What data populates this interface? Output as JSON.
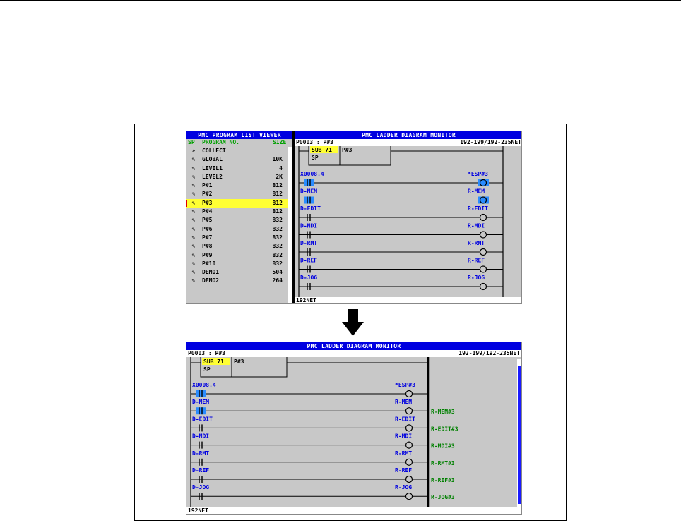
{
  "top": {
    "list_title": "PMC PROGRAM LIST VIEWER",
    "list_header": {
      "sp": "SP",
      "program_no": "PROGRAM NO.",
      "size": "SIZE"
    },
    "programs": [
      {
        "name": "COLLECT",
        "size": "",
        "icon": "magnifier-icon"
      },
      {
        "name": "GLOBAL",
        "size": "10K",
        "icon": "pencil-icon"
      },
      {
        "name": "LEVEL1",
        "size": "4",
        "icon": "pencil-icon"
      },
      {
        "name": "LEVEL2",
        "size": "2K",
        "icon": "pencil-icon"
      },
      {
        "name": "P#1",
        "size": "812",
        "icon": "pencil-icon"
      },
      {
        "name": "P#2",
        "size": "812",
        "icon": "pencil-icon"
      },
      {
        "name": "P#3",
        "size": "812",
        "icon": "pencil-icon",
        "selected": true
      },
      {
        "name": "P#4",
        "size": "812",
        "icon": "pencil-icon"
      },
      {
        "name": "P#5",
        "size": "832",
        "icon": "pencil-icon"
      },
      {
        "name": "P#6",
        "size": "832",
        "icon": "pencil-icon"
      },
      {
        "name": "P#7",
        "size": "832",
        "icon": "pencil-icon"
      },
      {
        "name": "P#8",
        "size": "832",
        "icon": "pencil-icon"
      },
      {
        "name": "P#9",
        "size": "832",
        "icon": "pencil-icon"
      },
      {
        "name": "P#10",
        "size": "832",
        "icon": "pencil-icon"
      },
      {
        "name": "DEMO1",
        "size": "504",
        "icon": "pencil-icon"
      },
      {
        "name": "DEMO2",
        "size": "264",
        "icon": "pencil-icon"
      }
    ],
    "ladder_title": "PMC LADDER DIAGRAM MONITOR",
    "info_left": "P0003 : P#3",
    "info_right": "192-199/192-235NET",
    "status": "192NET"
  },
  "bottom": {
    "ladder_title": "PMC LADDER DIAGRAM MONITOR",
    "info_left": "P0003 : P#3",
    "info_right": "192-199/192-235NET",
    "status": "192NET"
  },
  "ladder": {
    "sub_box": {
      "sub": "SUB 71",
      "sp": "SP",
      "program": "P#3"
    },
    "first_contact": "X0008.4",
    "first_coil": "*ESP#3",
    "rungs": [
      {
        "contact": "D-MEM",
        "coil": "R-MEM",
        "comment": "R-MEM#3"
      },
      {
        "contact": "D-EDIT",
        "coil": "R-EDIT",
        "comment": "R-EDIT#3"
      },
      {
        "contact": "D-MDI",
        "coil": "R-MDI",
        "comment": "R-MDI#3"
      },
      {
        "contact": "D-RMT",
        "coil": "R-RMT",
        "comment": "R-RMT#3"
      },
      {
        "contact": "D-REF",
        "coil": "R-REF",
        "comment": "R-REF#3"
      },
      {
        "contact": "D-JOG",
        "coil": "R-JOG",
        "comment": "R-JOG#3"
      }
    ]
  },
  "colors": {
    "title_bg": "#0000e0",
    "panel_bg": "#c8c8c8",
    "label_blue": "#0000e0",
    "comment_green": "#008000",
    "highlight_yellow": "#ffff33"
  }
}
